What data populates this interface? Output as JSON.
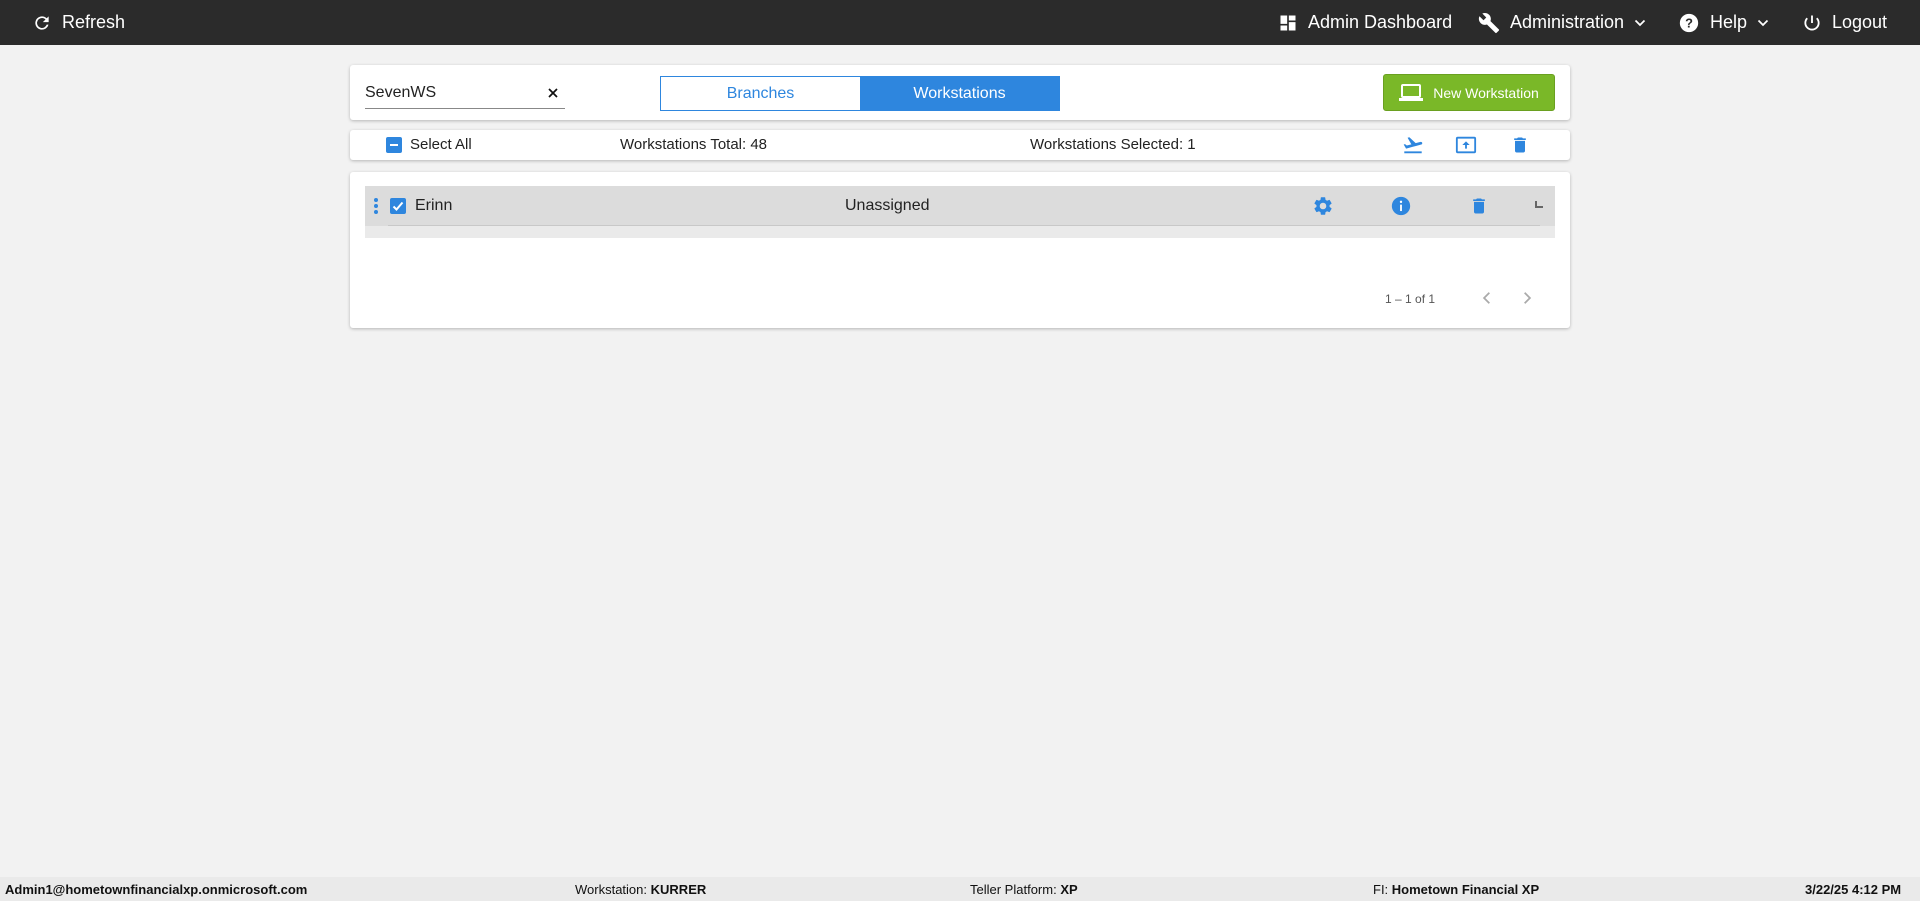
{
  "topbar": {
    "refresh_label": "Refresh",
    "admin_dashboard_label": "Admin Dashboard",
    "administration_label": "Administration",
    "help_label": "Help",
    "logout_label": "Logout"
  },
  "search": {
    "value": "SevenWS",
    "placeholder": ""
  },
  "tabs": {
    "branches_label": "Branches",
    "workstations_label": "Workstations",
    "active": "Workstations"
  },
  "new_workstation_label": "New Workstation",
  "selection_bar": {
    "select_all_label": "Select All",
    "total_label": "Workstations Total: 48",
    "selected_label": "Workstations Selected: 1",
    "icons": [
      "takeoff-icon",
      "upload-icon",
      "trash-icon"
    ]
  },
  "rows": [
    {
      "name": "Erinn",
      "status": "Unassigned",
      "checked": true,
      "icons": [
        "gear-icon",
        "info-icon",
        "trash-icon",
        "spinner-icon"
      ]
    }
  ],
  "pager": {
    "range_label": "1 – 1 of 1"
  },
  "footer": {
    "user": "Admin1@hometownfinancialxp.onmicrosoft.com",
    "workstation_label": "Workstation:",
    "workstation_value": "KURRER",
    "platform_label": "Teller Platform:",
    "platform_value": "XP",
    "fi_label": "FI:",
    "fi_value": "Hometown Financial XP",
    "datetime": "3/22/25 4:12 PM"
  },
  "colors": {
    "topbar": "#2b2b2b",
    "accent": "#2e86de",
    "green": "#7ab828",
    "background": "#f2f2f2"
  }
}
